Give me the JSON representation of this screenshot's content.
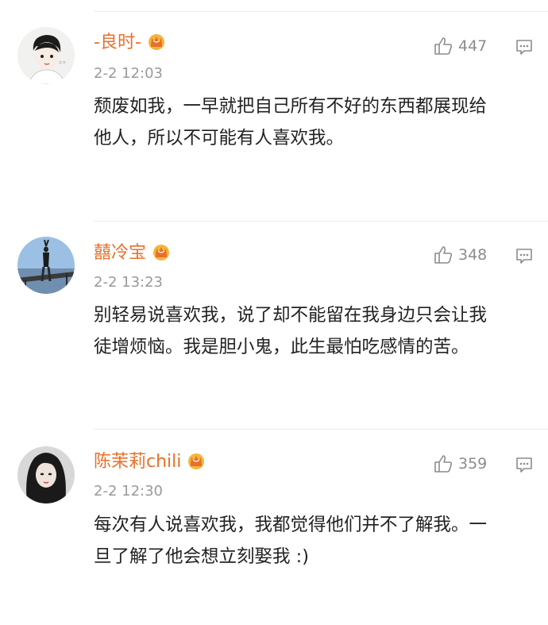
{
  "comments": [
    {
      "username": "-良时-",
      "time": "2-2 12:03",
      "likes": "447",
      "lines": [
        "颓废如我，一早就把自己所有不好的东西都展现给",
        "他人，所以不可能有人喜欢我。"
      ]
    },
    {
      "username": "囍冷宝",
      "time": "2-2 13:23",
      "likes": "348",
      "lines": [
        "别轻易说喜欢我，说了却不能留在我身边只会让我",
        "徒增烦恼。我是胆小鬼，此生最怕吃感情的苦。"
      ]
    },
    {
      "username": "陈茉莉chili",
      "time": "2-2 12:30",
      "likes": "359",
      "lines": [
        "每次有人说喜欢我，我都觉得他们并不了解我。一",
        "旦了解了他会想立刻娶我 :)"
      ]
    }
  ],
  "icons": {
    "crown": "crown-badge-icon",
    "like": "thumbs-up-icon",
    "reply": "comment-bubble-icon"
  },
  "colors": {
    "username": "#e8702a",
    "crown": "#f0a020",
    "muted": "#9a9a9a"
  }
}
